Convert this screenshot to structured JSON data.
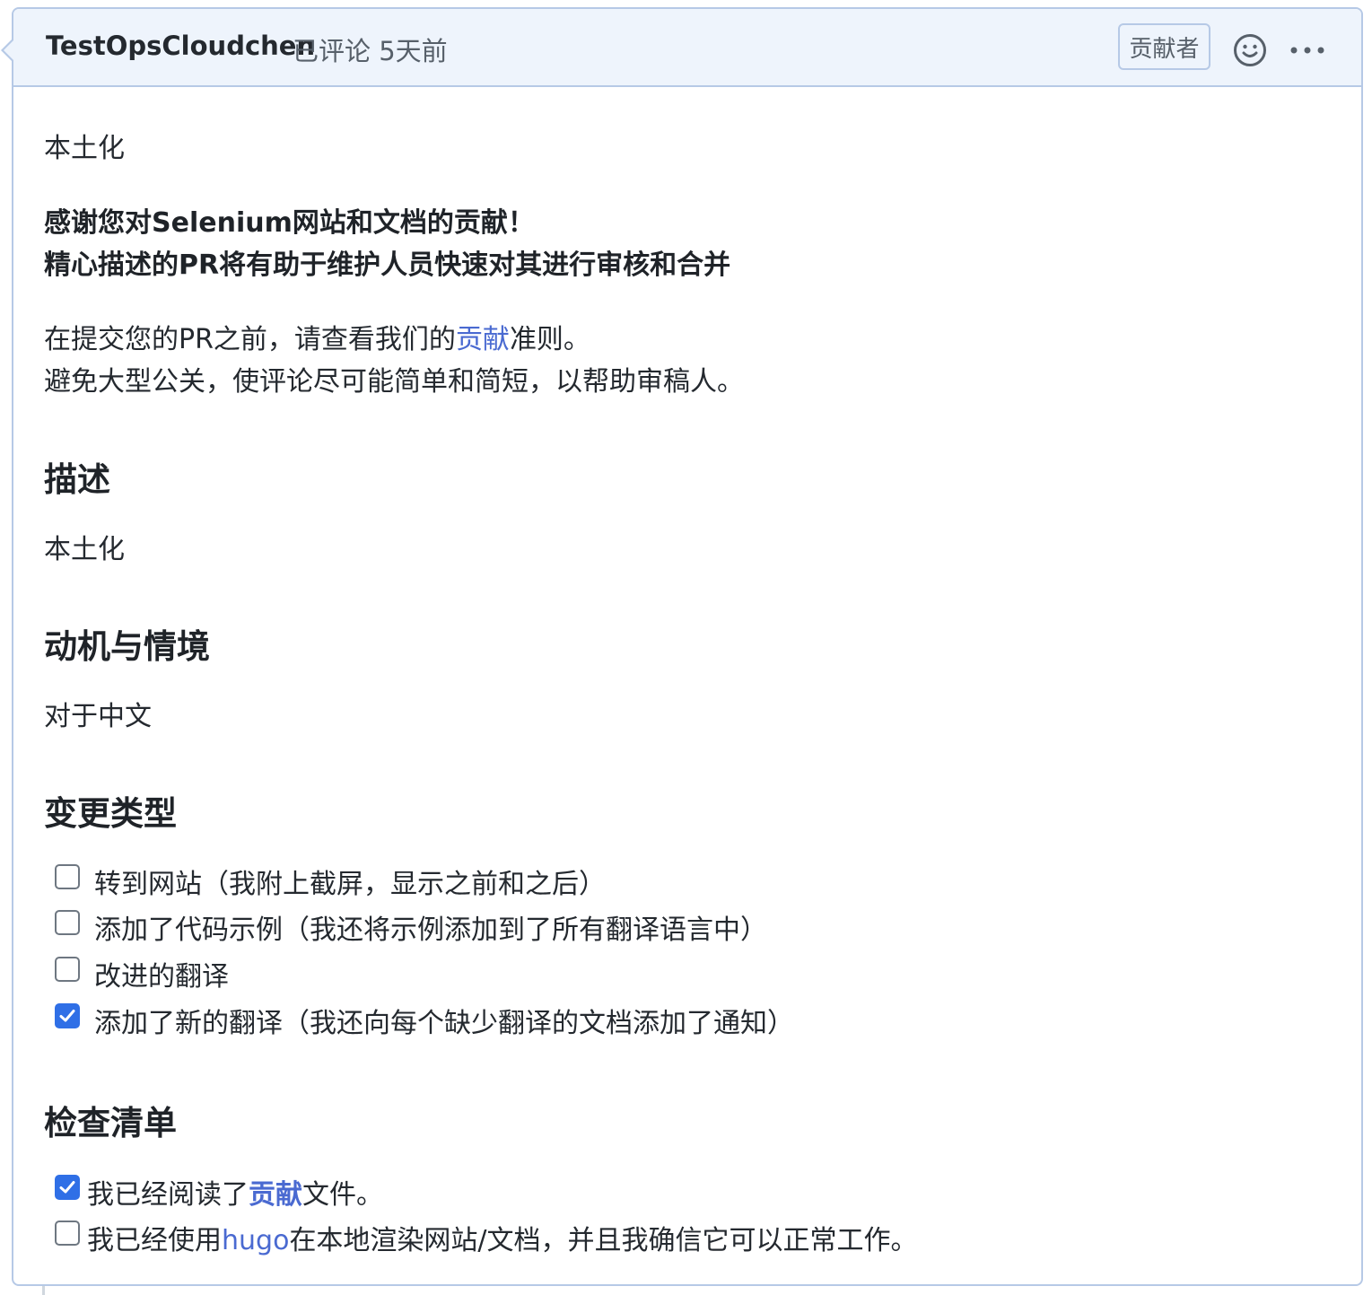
{
  "comment": {
    "author": "TestOpsCloudchen",
    "meta": "已评论 5天前",
    "badge": "贡献者",
    "emoji_icon": "smiley-icon",
    "more_icon": "kebab-horizontal-icon"
  },
  "body": {
    "title": "本土化",
    "thanks_line1": "感谢您对Selenium网站和文档的贡献！",
    "thanks_line2": "精心描述的PR将有助于维护人员快速对其进行审核和合并",
    "guide_prefix": "在提交您的PR之前，请查看我们的",
    "guide_link": "贡献",
    "guide_suffix": "准则。",
    "guide_line2": "避免大型公关，使评论尽可能简单和简短，以帮助审稿人。",
    "sections": {
      "description": {
        "heading": "描述",
        "text": "本土化"
      },
      "motivation": {
        "heading": "动机与情境",
        "text": "对于中文"
      },
      "change_type": {
        "heading": "变更类型",
        "items": [
          {
            "label": "转到网站（我附上截屏，显示之前和之后）",
            "checked": false
          },
          {
            "label": "添加了代码示例（我还将示例添加到了所有翻译语言中）",
            "checked": false
          },
          {
            "label": "改进的翻译",
            "checked": false
          },
          {
            "label": "添加了新的翻译（我还向每个缺少翻译的文档添加了通知）",
            "checked": true
          }
        ]
      },
      "checklist": {
        "heading": "检查清单",
        "item1_prefix": "我已经阅读了",
        "item1_link": "贡献",
        "item1_suffix": "文件。",
        "item1_checked": true,
        "item2_prefix": "我已经使用",
        "item2_link": "hugo",
        "item2_suffix": "在本地渲染网站/文档，并且我确信它可以正常工作。",
        "item2_checked": false
      }
    }
  }
}
